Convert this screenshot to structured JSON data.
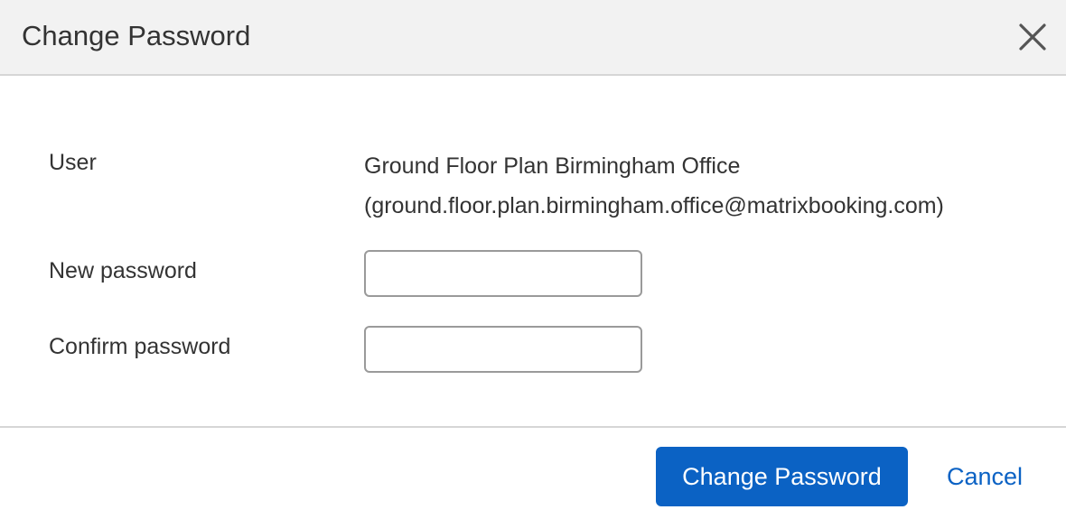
{
  "dialog": {
    "title": "Change Password",
    "close_icon": "close-icon"
  },
  "form": {
    "user_label": "User",
    "user_name": "Ground Floor Plan Birmingham Office",
    "user_email": "(ground.floor.plan.birmingham.office@matrixbooking.com)",
    "new_password_label": "New password",
    "new_password_value": "",
    "confirm_password_label": "Confirm password",
    "confirm_password_value": ""
  },
  "footer": {
    "submit_label": "Change Password",
    "cancel_label": "Cancel"
  },
  "colors": {
    "primary": "#0b62c4",
    "header_bg": "#f2f2f2",
    "divider": "#d6d6d6",
    "text": "#333333"
  }
}
